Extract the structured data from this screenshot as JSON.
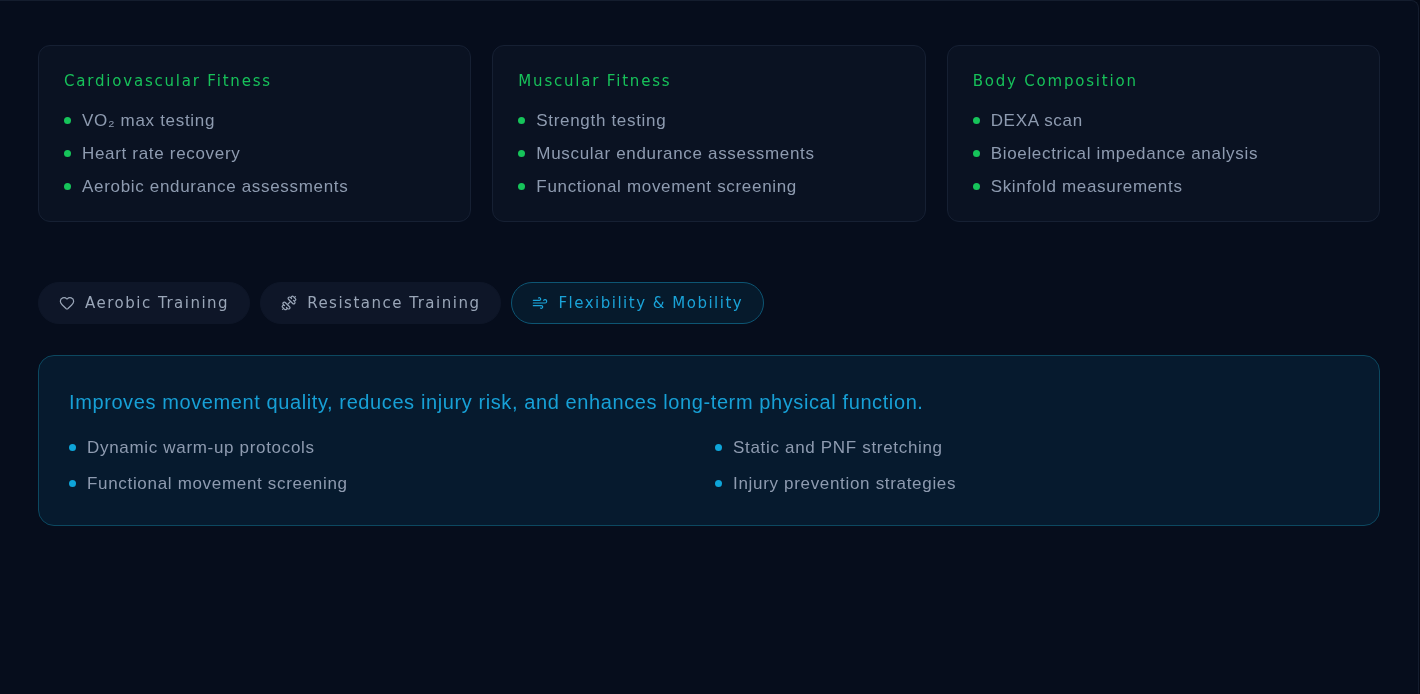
{
  "assessment_cards": [
    {
      "title": "Cardiovascular Fitness",
      "items": [
        "VO₂ max testing",
        "Heart rate recovery",
        "Aerobic endurance assessments"
      ]
    },
    {
      "title": "Muscular Fitness",
      "items": [
        "Strength testing",
        "Muscular endurance assessments",
        "Functional movement screening"
      ]
    },
    {
      "title": "Body Composition",
      "items": [
        "DEXA scan",
        "Bioelectrical impedance analysis",
        "Skinfold measurements"
      ]
    }
  ],
  "tabs": [
    {
      "label": "Aerobic Training",
      "selected": false
    },
    {
      "label": "Resistance Training",
      "selected": false
    },
    {
      "label": "Flexibility & Mobility",
      "selected": true
    }
  ],
  "panel": {
    "description": "Improves movement quality, reduces injury risk, and enhances long-term physical function.",
    "items": [
      "Dynamic warm-up protocols",
      "Static and PNF stretching",
      "Functional movement screening",
      "Injury prevention strategies"
    ]
  }
}
